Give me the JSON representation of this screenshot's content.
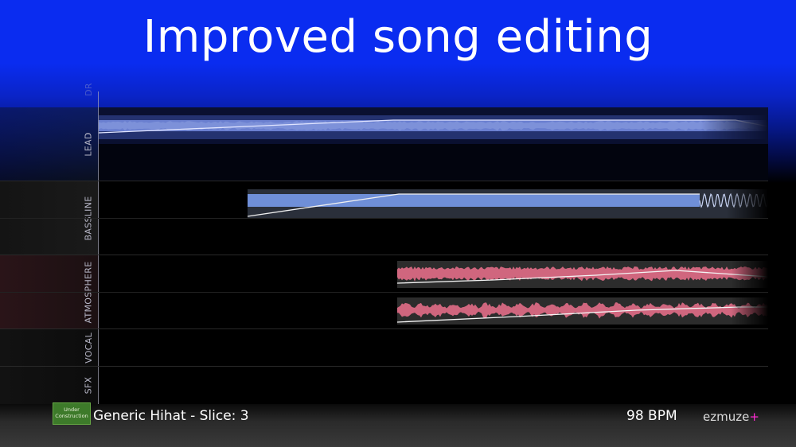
{
  "title": "Improved song editing",
  "tracks": [
    {
      "label": "DR"
    },
    {
      "label": "LEAD"
    },
    {
      "label": "BASSLINE"
    },
    {
      "label": "ATMOSPHERE"
    },
    {
      "label": "VOCAL"
    },
    {
      "label": "SFX"
    }
  ],
  "footer": {
    "badge_line1": "Under",
    "badge_line2": "Construction",
    "sample_name": "Generic Hihat - Slice: 3",
    "bpm": "98 BPM",
    "brand": "ezmuze",
    "brand_plus": "+"
  },
  "colors": {
    "header_blue": "#0a2cf0",
    "lead_clip": "#6a7fd0",
    "bass_clip": "#6f8fd8",
    "atmos_clip": "#d0667e",
    "brand_plus": "#ff2bd4"
  },
  "icons": [
    "under-construction-badge"
  ]
}
